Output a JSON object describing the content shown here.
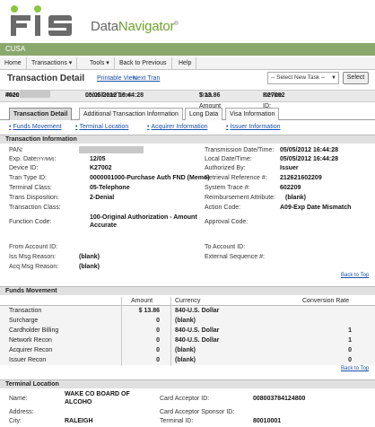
{
  "brand": {
    "logo_text": "FIS",
    "product_prefix": "Data",
    "product_name": "Navigator",
    "trademark": "®"
  },
  "org": {
    "name": "CUSA"
  },
  "menu": {
    "items": [
      {
        "label": "Home",
        "has_dropdown": false
      },
      {
        "label": "Transactions",
        "has_dropdown": true
      },
      {
        "label": "Tools",
        "has_dropdown": true
      },
      {
        "label": "Back to Previous",
        "has_dropdown": false
      },
      {
        "label": "Help",
        "has_dropdown": false
      }
    ]
  },
  "title_bar": {
    "title": "Transaction Detail",
    "printable_view": "Printable View",
    "next_tran": "Next Tran",
    "task_select": "-- Select New Task --",
    "select_button": "Select"
  },
  "pan_strip": {
    "pan_label": "PAN:",
    "pan_value": "4020",
    "local_datetime_label": "Local Date/Time:",
    "local_datetime_value": "05/05/2012 16:44:28",
    "tran_amount_label": "Tran Amount",
    "tran_amount_value": "$ 13.86",
    "device_id_label": "Device ID:",
    "device_id_value": "K27002"
  },
  "tabs": [
    {
      "label": "Transaction Detail",
      "active": true
    },
    {
      "label": "Additional Transaction Information",
      "active": false
    },
    {
      "label": "Long Data",
      "active": false
    },
    {
      "label": "Visa Information",
      "active": false
    }
  ],
  "section_links": [
    {
      "label": "Funds Movement"
    },
    {
      "label": "Terminal Location"
    },
    {
      "label": "Acquirer Information"
    },
    {
      "label": "Issuer Information"
    }
  ],
  "transaction_info": {
    "section_title": "Transaction Information",
    "left": [
      {
        "label": "PAN:",
        "value": ""
      },
      {
        "label": "Exp. Date",
        "label_hint": "(YY/MM)",
        "value": "12/05"
      },
      {
        "label": "Device ID:",
        "value": "K27002"
      },
      {
        "label": "Tran Type ID:",
        "value": "0000001000-Purchase Auth FND (Memo)"
      },
      {
        "label": "Terminal Class:",
        "value": "05-Telephone"
      },
      {
        "label": "Trans Disposition:",
        "value": "2-Denial"
      },
      {
        "label": "Transaction Class:",
        "value": ""
      },
      {
        "label": "Function Code:",
        "value": "100-Original Authorization - Amount Accurate"
      },
      {
        "label": "From Account ID:",
        "value": ""
      },
      {
        "label": "Iss Msg Reason:",
        "value": "(blank)"
      },
      {
        "label": "Acq Msg Reason:",
        "value": "(blank)"
      }
    ],
    "right": [
      {
        "label": "Transmission Date/Time:",
        "value": "05/05/2012 16:44:28"
      },
      {
        "label": "Local Date/Time:",
        "value": "05/05/2012 16:44:28"
      },
      {
        "label": "Authorized By:",
        "value": "Issuer"
      },
      {
        "label": "Retrieval Reference #:",
        "value": "212621602209"
      },
      {
        "label": "System Trace #:",
        "value": "602209"
      },
      {
        "label": "Reimbursement Attribute:",
        "value": "(blank)"
      },
      {
        "label": "Action Code:",
        "value": "A09-Exp Date Mismatch"
      },
      {
        "label": "Approval Code:",
        "value": ""
      },
      {
        "label": "To Account ID:",
        "value": ""
      },
      {
        "label": "External Sequence #:",
        "value": ""
      }
    ],
    "back_to_top": "Back to Top"
  },
  "funds_movement": {
    "section_title": "Funds Movement",
    "columns": [
      "Amount",
      "Currency",
      "Conversion Rate"
    ],
    "rows": [
      {
        "label": "Transaction",
        "amount": "$ 13.86",
        "currency": "840-U.S. Dollar",
        "rate": ""
      },
      {
        "label": "Surcharge",
        "amount": "0",
        "currency": "(blank)",
        "rate": ""
      },
      {
        "label": "Cardholder Billing",
        "amount": "0",
        "currency": "840-U.S. Dollar",
        "rate": "1"
      },
      {
        "label": "Network Recon",
        "amount": "0",
        "currency": "840-U.S. Dollar",
        "rate": "1"
      },
      {
        "label": "Acquirer Recon",
        "amount": "0",
        "currency": "(blank)",
        "rate": "0"
      },
      {
        "label": "Issuer Recon",
        "amount": "0",
        "currency": "(blank)",
        "rate": "0"
      }
    ],
    "back_to_top": "Back to Top"
  },
  "terminal_location": {
    "section_title": "Terminal Location",
    "left": [
      {
        "label": "Name:",
        "value": "WAKE CO BOARD OF ALCOHO"
      },
      {
        "label": "Address:",
        "value": ""
      },
      {
        "label": "City:",
        "value": "RALEIGH"
      }
    ],
    "right": [
      {
        "label": "Card Acceptor ID:",
        "value": "008003784124800"
      },
      {
        "label": "Card Acceptor Sponsor ID:",
        "value": ""
      },
      {
        "label": "Terminal ID:",
        "value": "80010001"
      }
    ]
  }
}
